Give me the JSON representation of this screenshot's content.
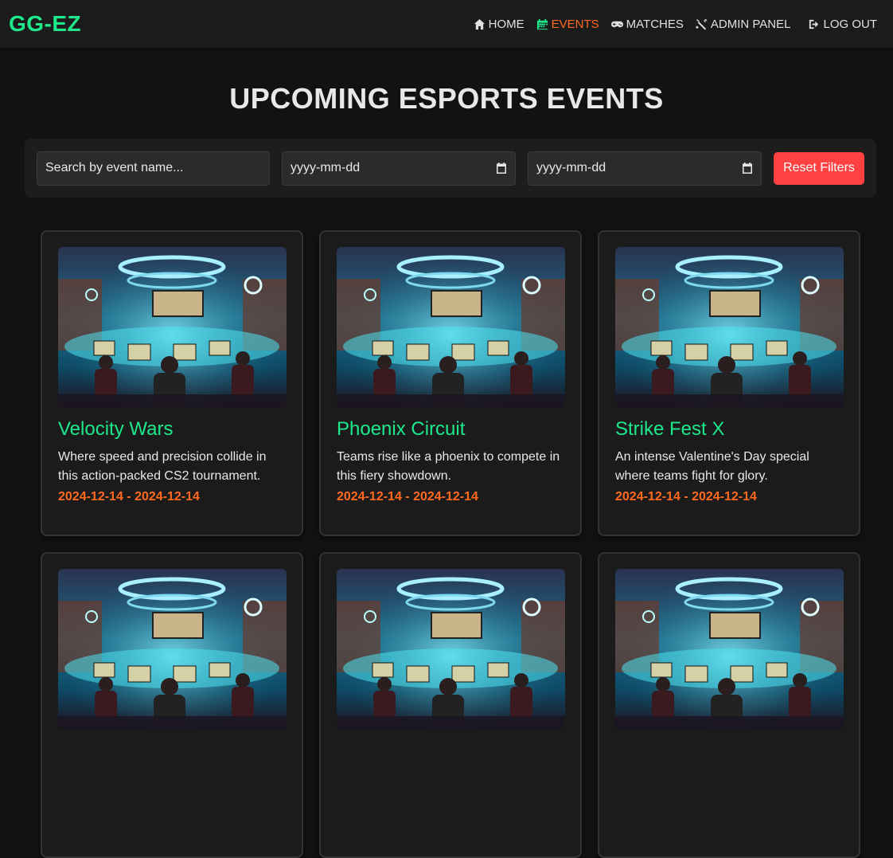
{
  "brand": "GG-EZ",
  "nav": {
    "home": "HOME",
    "events": "EVENTS",
    "matches": "MATCHES",
    "admin": "ADMIN PANEL",
    "logout": "LOG OUT"
  },
  "page_title": "UPCOMING ESPORTS EVENTS",
  "filters": {
    "search_placeholder": "Search by event name...",
    "start_date": "yyyy-mm-dd",
    "end_date": "yyyy-mm-dd",
    "reset_label": "Reset Filters"
  },
  "colors": {
    "accent_green": "#1de98b",
    "accent_orange": "#ff6a1f",
    "reset_red": "#ff4141",
    "background": "#121212"
  },
  "events": [
    {
      "name": "Velocity Wars",
      "description": "Where speed and precision collide in this action-packed CS2 tournament.",
      "dates": "2024-12-14 - 2024-12-14"
    },
    {
      "name": "Phoenix Circuit",
      "description": "Teams rise like a phoenix to compete in this fiery showdown.",
      "dates": "2024-12-14 - 2024-12-14"
    },
    {
      "name": "Strike Fest X",
      "description": "An intense Valentine's Day special where teams fight for glory.",
      "dates": "2024-12-14 - 2024-12-14"
    },
    {
      "name": "",
      "description": "",
      "dates": ""
    },
    {
      "name": "",
      "description": "",
      "dates": ""
    },
    {
      "name": "",
      "description": "",
      "dates": ""
    }
  ]
}
